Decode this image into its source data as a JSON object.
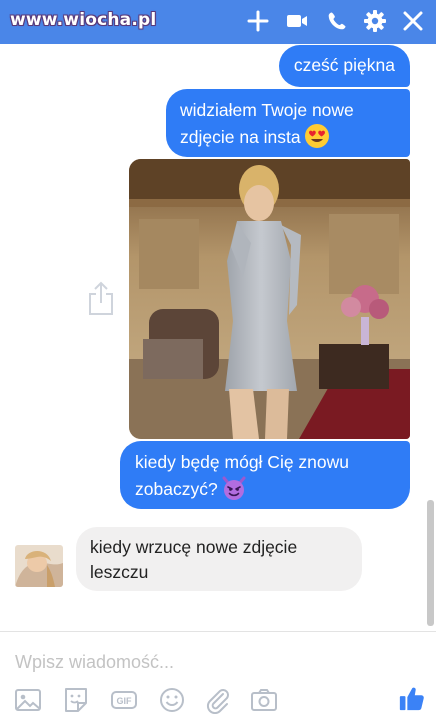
{
  "header": {
    "watermark": "www.wiocha.pl",
    "icons": [
      "plus-icon",
      "video-camera-icon",
      "phone-icon",
      "gear-icon",
      "close-icon"
    ],
    "bg_color": "#4a86e8"
  },
  "messages": [
    {
      "sender": "me",
      "text": "cześć piękna"
    },
    {
      "sender": "me",
      "text": "widziałem Twoje nowe zdjęcie na insta",
      "emoji": "heart-eyes-emoji"
    },
    {
      "sender": "me",
      "type": "photo",
      "icon": "share-icon"
    },
    {
      "sender": "me",
      "text": "kiedy będę mógł Cię znowu zobaczyć?",
      "emoji": "devil-emoji"
    },
    {
      "sender": "them",
      "text": "kiedy wrzucę nowe zdjęcie leszczu"
    }
  ],
  "composer": {
    "placeholder": "Wpisz wiadomość...",
    "tools": [
      "image-icon",
      "sticker-icon",
      "gif-icon",
      "emoji-icon",
      "attachment-icon",
      "camera-icon",
      "like-icon"
    ],
    "accent": "#2f7cf6"
  }
}
